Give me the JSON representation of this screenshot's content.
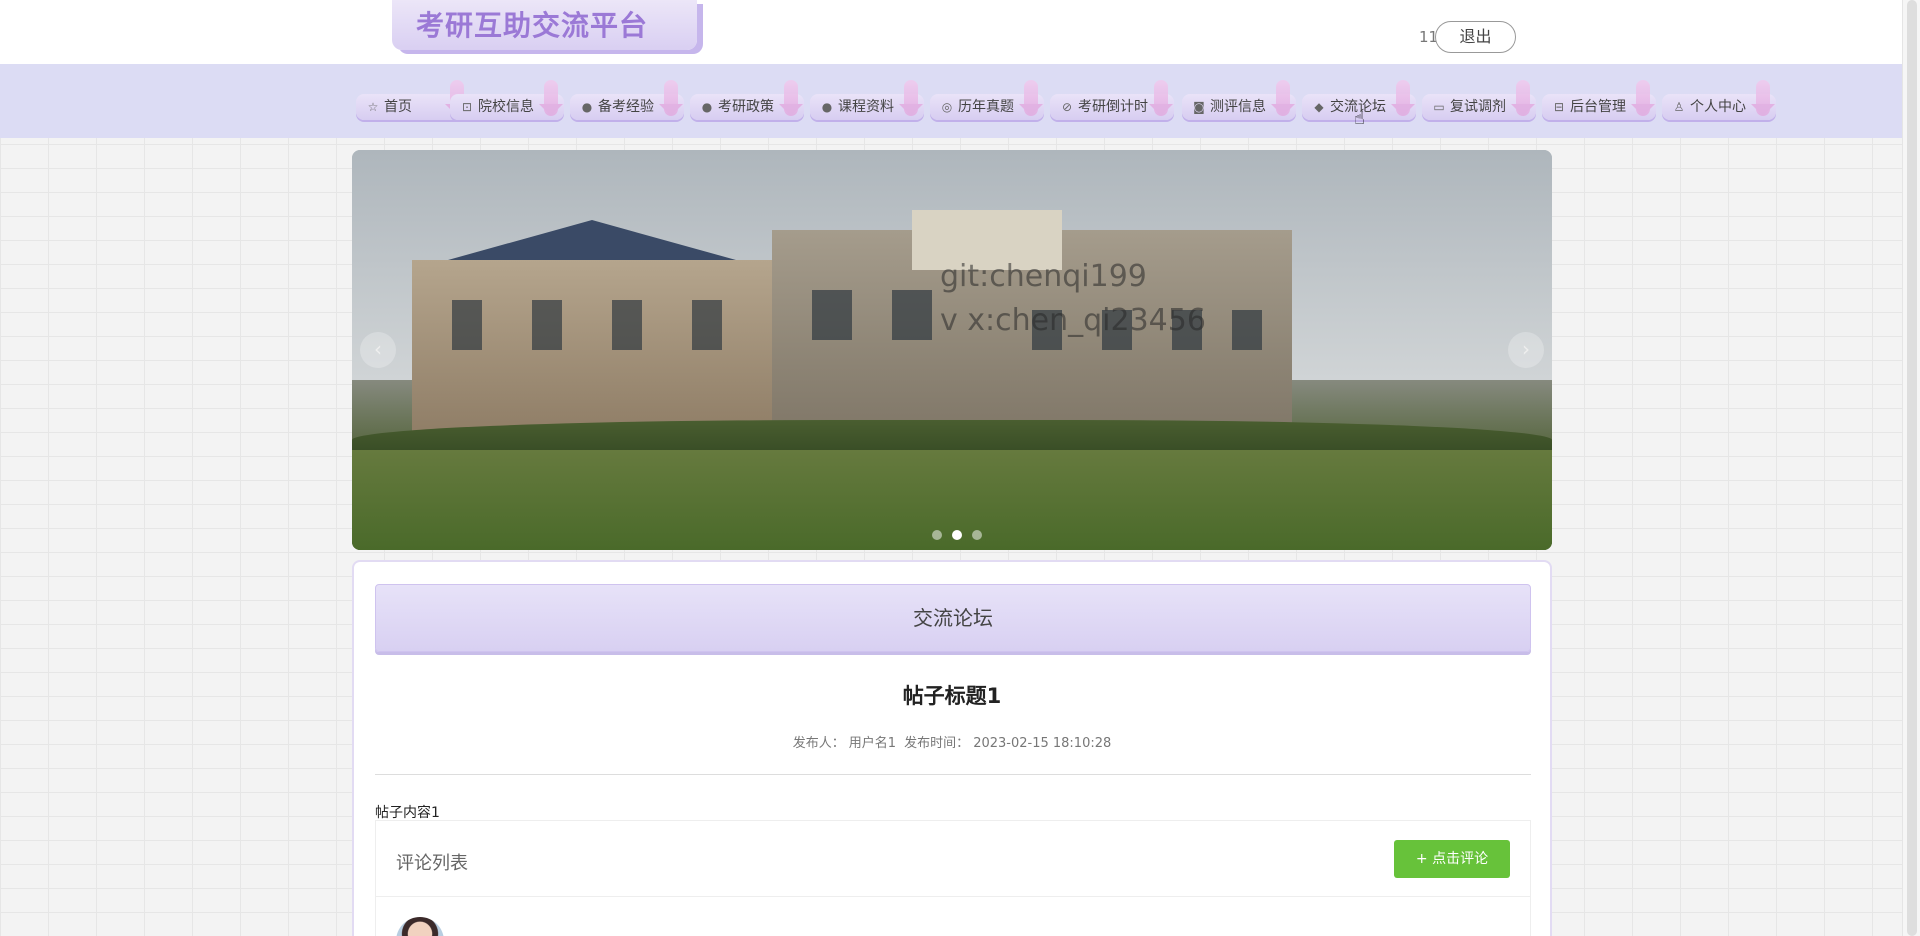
{
  "header": {
    "site_title": "考研互助交流平台",
    "user_label": "11",
    "logout_label": "退出"
  },
  "nav": {
    "items": [
      {
        "label": "首页",
        "icon": "star-icon"
      },
      {
        "label": "院校信息",
        "icon": "bag-icon"
      },
      {
        "label": "备考经验",
        "icon": "info-icon"
      },
      {
        "label": "考研政策",
        "icon": "question-icon"
      },
      {
        "label": "课程资料",
        "icon": "info-icon"
      },
      {
        "label": "历年真题",
        "icon": "at-icon"
      },
      {
        "label": "考研倒计时",
        "icon": "check-circle-icon"
      },
      {
        "label": "测评信息",
        "icon": "camera-icon"
      },
      {
        "label": "交流论坛",
        "icon": "car-icon"
      },
      {
        "label": "复试调剂",
        "icon": "video-icon"
      },
      {
        "label": "后台管理",
        "icon": "box-icon"
      },
      {
        "label": "个人中心",
        "icon": "user-icon"
      }
    ]
  },
  "banner": {
    "watermark_line1": "git:chenqi199",
    "watermark_line2": "v x:chen_qi23456",
    "prev_label": "‹",
    "next_label": "›",
    "active_dot": 2
  },
  "main": {
    "section_title": "交流论坛",
    "post_title": "帖子标题1",
    "author_label": "发布人：",
    "author_name": "用户名1",
    "time_label": "发布时间：",
    "time_value": "2023-02-15 18:10:28",
    "post_content": "帖子内容1",
    "comments_label": "评论列表",
    "comment_button": "+ 点击评论"
  },
  "colors": {
    "nav_band": "#dcdcf4",
    "accent_purple": "#9b79d6",
    "comment_button": "#67c23a"
  }
}
